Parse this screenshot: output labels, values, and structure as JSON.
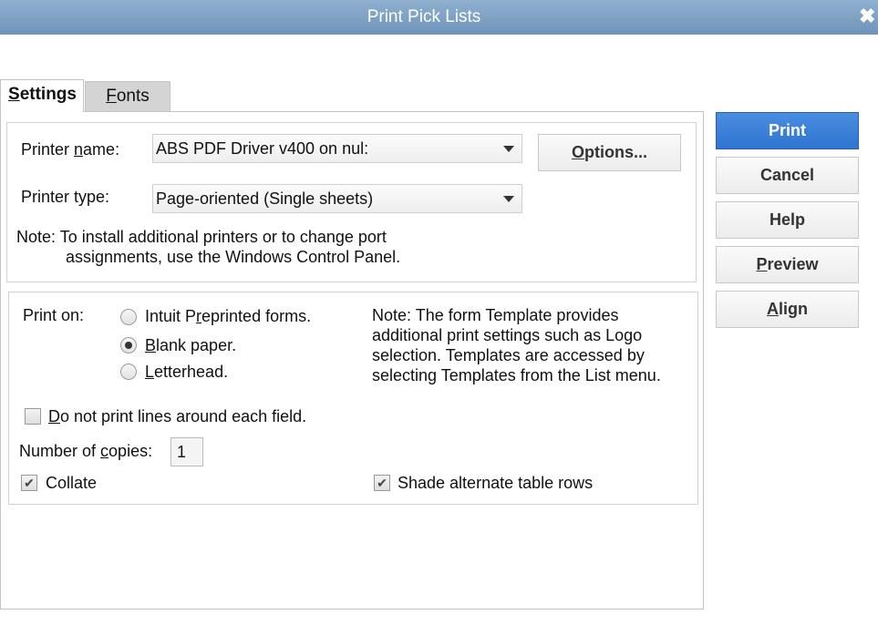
{
  "window": {
    "title": "Print Pick Lists"
  },
  "tabs": [
    {
      "pre": "",
      "key": "S",
      "post": "ettings"
    },
    {
      "pre": "",
      "key": "F",
      "post": "onts"
    }
  ],
  "printer": {
    "name_label": {
      "pre": "Printer ",
      "key": "n",
      "post": "ame:"
    },
    "name_value": "ABS PDF Driver v400 on nul:",
    "type_label": "Printer type:",
    "type_value": "Page-oriented (Single sheets)",
    "options_button": {
      "pre": "",
      "key": "O",
      "post": "ptions..."
    },
    "note_line1": "Note: To install additional printers or to change port",
    "note_line2": "assignments, use the Windows Control Panel."
  },
  "print_on": {
    "label": "Print on:",
    "options": [
      {
        "pre": "Intuit P",
        "key": "r",
        "post": "eprinted forms.",
        "selected": false
      },
      {
        "pre": "",
        "key": "B",
        "post": "lank paper.",
        "selected": true
      },
      {
        "pre": "",
        "key": "L",
        "post": "etterhead.",
        "selected": false
      }
    ],
    "note_lines": [
      "Note: The form Template provides",
      "additional print settings such as Logo",
      "selection.  Templates are accessed by",
      "selecting Templates from the List menu."
    ]
  },
  "options": {
    "no_lines": {
      "pre": "",
      "key": "D",
      "post": "o not print lines around each field.",
      "checked": false
    },
    "copies_label": {
      "pre": "Number of ",
      "key": "c",
      "post": "opies:"
    },
    "copies_value": "1",
    "collate": {
      "label": "Collate",
      "checked": true
    },
    "shade": {
      "label": "Shade alternate table rows",
      "checked": true
    }
  },
  "buttons": {
    "print": {
      "pre": "",
      "key": "",
      "post": "Print"
    },
    "cancel": {
      "pre": "",
      "key": "",
      "post": "Cancel"
    },
    "help": {
      "pre": "",
      "key": "",
      "post": "Help"
    },
    "preview": {
      "pre": "",
      "key": "P",
      "post": "review"
    },
    "align": {
      "pre": "",
      "key": "A",
      "post": "lign"
    }
  },
  "colors": {
    "titlebar": "#7fa2c4",
    "primary_button": "#3a7fd8"
  }
}
